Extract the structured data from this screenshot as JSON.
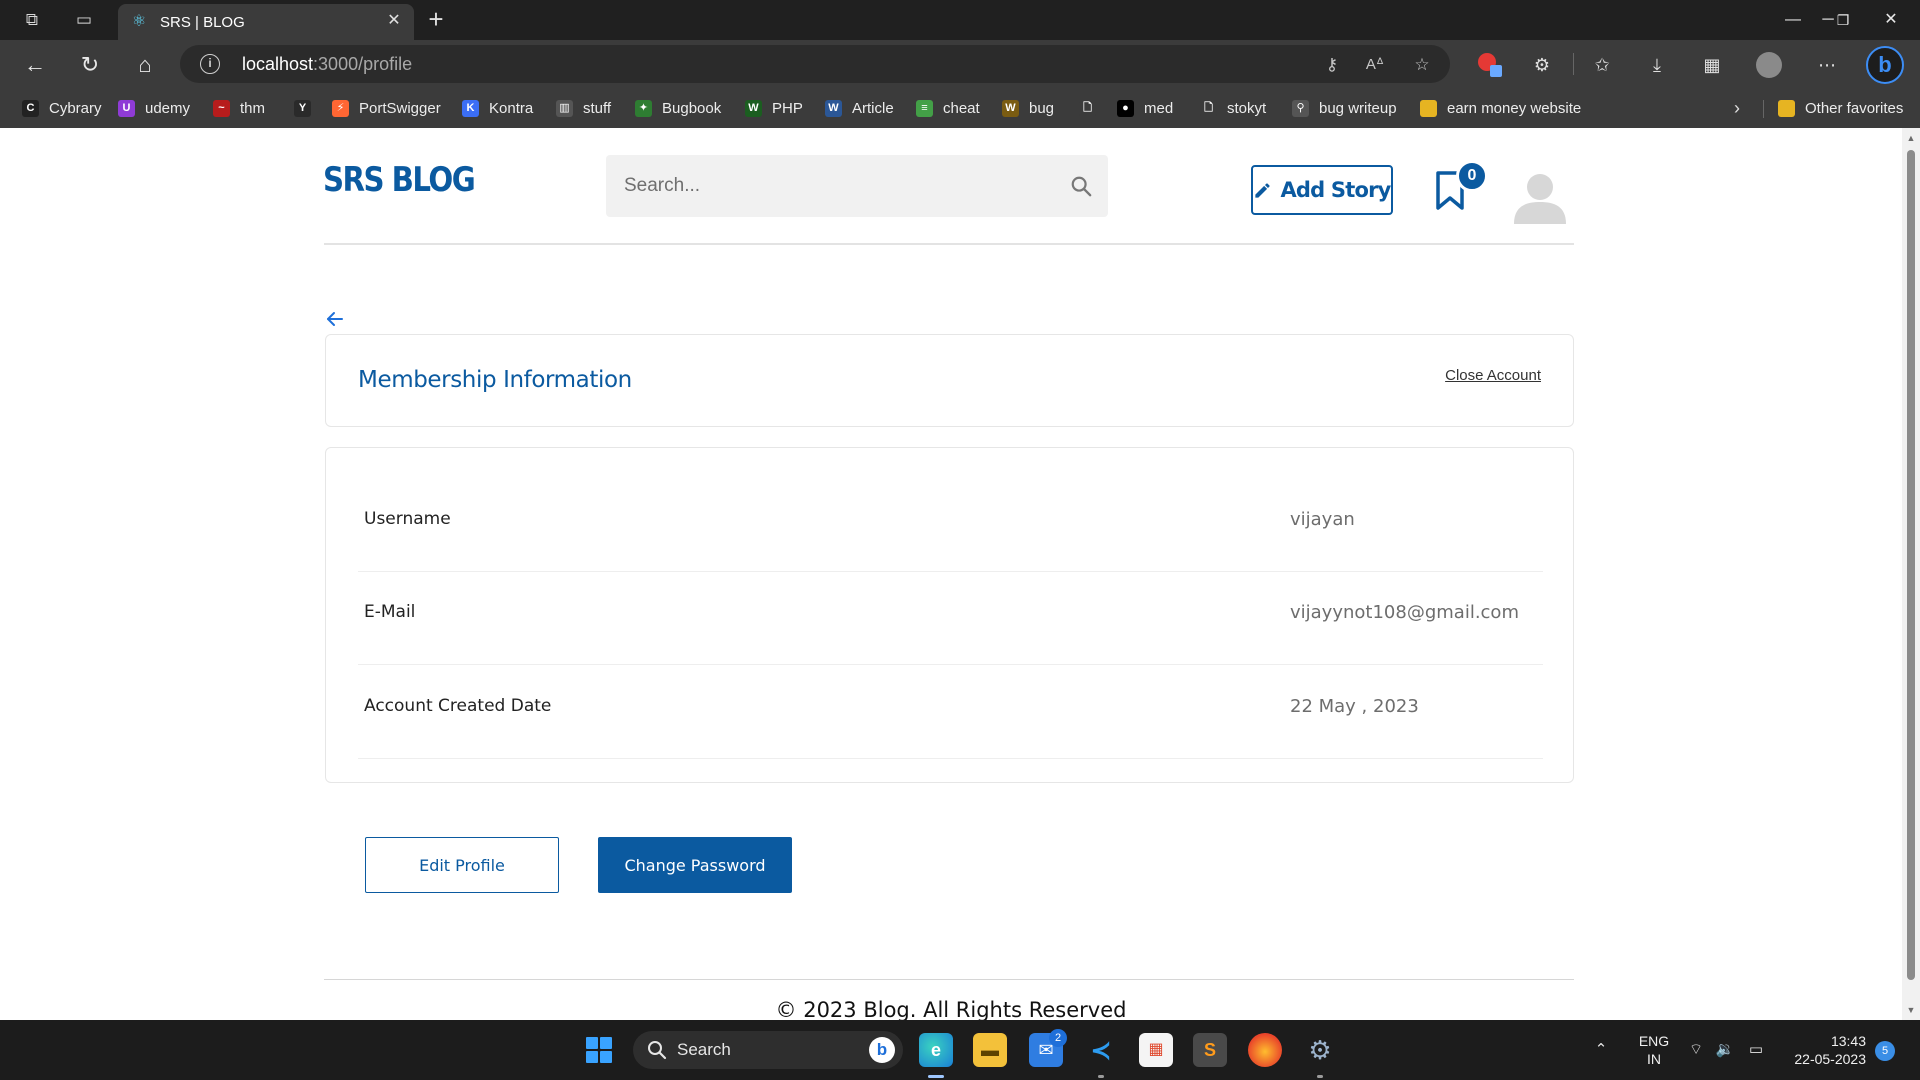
{
  "browser": {
    "tab_title": "SRS | BLOG",
    "url_host": "localhost",
    "url_path": ":3000/profile",
    "bookmarks": [
      {
        "label": "Cybrary",
        "color": "#222222",
        "glyph": "C"
      },
      {
        "label": "udemy",
        "color": "#8f3bd6",
        "glyph": "U"
      },
      {
        "label": "thm",
        "color": "#b71c1c",
        "glyph": "~"
      },
      {
        "label": "",
        "color": "#2a2a2a",
        "glyph": "Y"
      },
      {
        "label": "PortSwigger",
        "color": "#ff6633",
        "glyph": "⚡"
      },
      {
        "label": "Kontra",
        "color": "#3b6ef5",
        "glyph": "K"
      },
      {
        "label": "stuff",
        "color": "#555555",
        "glyph": "▥"
      },
      {
        "label": "Bugbook",
        "color": "#2e7d32",
        "glyph": "✦"
      },
      {
        "label": "PHP",
        "color": "#1b5e20",
        "glyph": "W"
      },
      {
        "label": "Article",
        "color": "#2b5797",
        "glyph": "W"
      },
      {
        "label": "cheat",
        "color": "#43a047",
        "glyph": "≡"
      },
      {
        "label": "bug",
        "color": "#7a5c12",
        "glyph": "W"
      },
      {
        "label": "",
        "color": "#3b3b3b",
        "glyph": "🗋"
      },
      {
        "label": "med",
        "color": "#000000",
        "glyph": "●"
      },
      {
        "label": "stokyt",
        "color": "#3b3b3b",
        "glyph": "🗋"
      },
      {
        "label": "bug writeup",
        "color": "#555555",
        "glyph": "⚲"
      },
      {
        "label": "earn money website",
        "color": "#e6b422",
        "glyph": ""
      }
    ],
    "other_favorites": "Other favorites"
  },
  "header": {
    "logo": "SRS BLOG",
    "search_placeholder": "Search...",
    "add_story": "Add Story",
    "bookmark_count": "0"
  },
  "membership": {
    "title": "Membership Information",
    "close_account": "Close Account",
    "rows": [
      {
        "label": "Username",
        "value": "vijayan"
      },
      {
        "label": "E-Mail",
        "value": "vijayynot108@gmail.com"
      },
      {
        "label": "Account Created Date",
        "value": "22 May , 2023"
      }
    ]
  },
  "actions": {
    "edit_profile": "Edit Profile",
    "change_password": "Change Password"
  },
  "footer": {
    "text": "© 2023 Blog. All Rights Reserved"
  },
  "taskbar": {
    "search_label": "Search",
    "mail_badge": "2",
    "lang_line1": "ENG",
    "lang_line2": "IN",
    "time": "13:43",
    "date": "22-05-2023",
    "notifications": "5"
  },
  "colors": {
    "brand": "#0b5aa0",
    "chrome": "#3b3b3b"
  }
}
